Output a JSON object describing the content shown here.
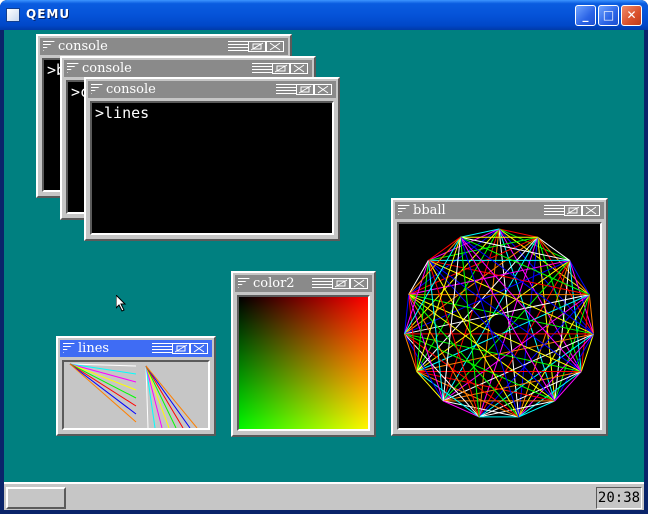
{
  "host": {
    "title": "QEMU",
    "minimize_glyph": "_",
    "maximize_glyph": "□",
    "close_glyph": "✕"
  },
  "windows": {
    "console1": {
      "title": "console",
      "text": ">b"
    },
    "console2": {
      "title": "console",
      "text": ">c"
    },
    "console3": {
      "title": "console",
      "text": ">lines"
    },
    "bball": {
      "title": "bball"
    },
    "color2": {
      "title": "color2"
    },
    "lines": {
      "title": "lines"
    }
  },
  "taskbar": {
    "clock": "20:38"
  },
  "colors": {
    "desktop": "#008080",
    "window_face": "#c6c6c6",
    "inactive_title": "#8a8a8a",
    "active_title": "#3f6cf4"
  }
}
